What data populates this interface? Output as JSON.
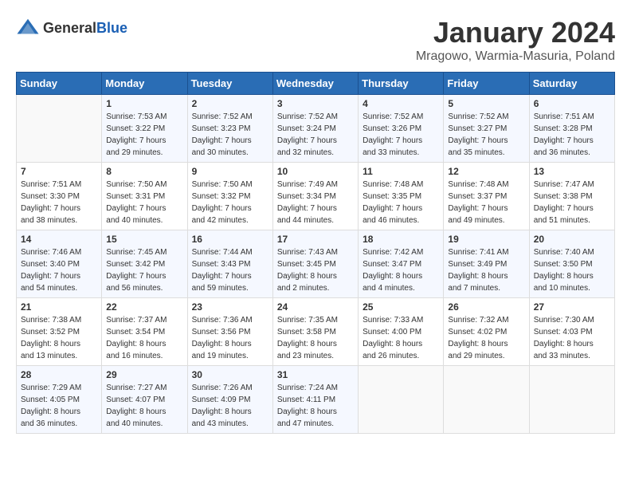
{
  "logo": {
    "text_general": "General",
    "text_blue": "Blue"
  },
  "title": "January 2024",
  "location": "Mragowo, Warmia-Masuria, Poland",
  "days_of_week": [
    "Sunday",
    "Monday",
    "Tuesday",
    "Wednesday",
    "Thursday",
    "Friday",
    "Saturday"
  ],
  "weeks": [
    [
      {
        "day": "",
        "info": ""
      },
      {
        "day": "1",
        "info": "Sunrise: 7:53 AM\nSunset: 3:22 PM\nDaylight: 7 hours\nand 29 minutes."
      },
      {
        "day": "2",
        "info": "Sunrise: 7:52 AM\nSunset: 3:23 PM\nDaylight: 7 hours\nand 30 minutes."
      },
      {
        "day": "3",
        "info": "Sunrise: 7:52 AM\nSunset: 3:24 PM\nDaylight: 7 hours\nand 32 minutes."
      },
      {
        "day": "4",
        "info": "Sunrise: 7:52 AM\nSunset: 3:26 PM\nDaylight: 7 hours\nand 33 minutes."
      },
      {
        "day": "5",
        "info": "Sunrise: 7:52 AM\nSunset: 3:27 PM\nDaylight: 7 hours\nand 35 minutes."
      },
      {
        "day": "6",
        "info": "Sunrise: 7:51 AM\nSunset: 3:28 PM\nDaylight: 7 hours\nand 36 minutes."
      }
    ],
    [
      {
        "day": "7",
        "info": "Sunrise: 7:51 AM\nSunset: 3:30 PM\nDaylight: 7 hours\nand 38 minutes."
      },
      {
        "day": "8",
        "info": "Sunrise: 7:50 AM\nSunset: 3:31 PM\nDaylight: 7 hours\nand 40 minutes."
      },
      {
        "day": "9",
        "info": "Sunrise: 7:50 AM\nSunset: 3:32 PM\nDaylight: 7 hours\nand 42 minutes."
      },
      {
        "day": "10",
        "info": "Sunrise: 7:49 AM\nSunset: 3:34 PM\nDaylight: 7 hours\nand 44 minutes."
      },
      {
        "day": "11",
        "info": "Sunrise: 7:48 AM\nSunset: 3:35 PM\nDaylight: 7 hours\nand 46 minutes."
      },
      {
        "day": "12",
        "info": "Sunrise: 7:48 AM\nSunset: 3:37 PM\nDaylight: 7 hours\nand 49 minutes."
      },
      {
        "day": "13",
        "info": "Sunrise: 7:47 AM\nSunset: 3:38 PM\nDaylight: 7 hours\nand 51 minutes."
      }
    ],
    [
      {
        "day": "14",
        "info": "Sunrise: 7:46 AM\nSunset: 3:40 PM\nDaylight: 7 hours\nand 54 minutes."
      },
      {
        "day": "15",
        "info": "Sunrise: 7:45 AM\nSunset: 3:42 PM\nDaylight: 7 hours\nand 56 minutes."
      },
      {
        "day": "16",
        "info": "Sunrise: 7:44 AM\nSunset: 3:43 PM\nDaylight: 7 hours\nand 59 minutes."
      },
      {
        "day": "17",
        "info": "Sunrise: 7:43 AM\nSunset: 3:45 PM\nDaylight: 8 hours\nand 2 minutes."
      },
      {
        "day": "18",
        "info": "Sunrise: 7:42 AM\nSunset: 3:47 PM\nDaylight: 8 hours\nand 4 minutes."
      },
      {
        "day": "19",
        "info": "Sunrise: 7:41 AM\nSunset: 3:49 PM\nDaylight: 8 hours\nand 7 minutes."
      },
      {
        "day": "20",
        "info": "Sunrise: 7:40 AM\nSunset: 3:50 PM\nDaylight: 8 hours\nand 10 minutes."
      }
    ],
    [
      {
        "day": "21",
        "info": "Sunrise: 7:38 AM\nSunset: 3:52 PM\nDaylight: 8 hours\nand 13 minutes."
      },
      {
        "day": "22",
        "info": "Sunrise: 7:37 AM\nSunset: 3:54 PM\nDaylight: 8 hours\nand 16 minutes."
      },
      {
        "day": "23",
        "info": "Sunrise: 7:36 AM\nSunset: 3:56 PM\nDaylight: 8 hours\nand 19 minutes."
      },
      {
        "day": "24",
        "info": "Sunrise: 7:35 AM\nSunset: 3:58 PM\nDaylight: 8 hours\nand 23 minutes."
      },
      {
        "day": "25",
        "info": "Sunrise: 7:33 AM\nSunset: 4:00 PM\nDaylight: 8 hours\nand 26 minutes."
      },
      {
        "day": "26",
        "info": "Sunrise: 7:32 AM\nSunset: 4:02 PM\nDaylight: 8 hours\nand 29 minutes."
      },
      {
        "day": "27",
        "info": "Sunrise: 7:30 AM\nSunset: 4:03 PM\nDaylight: 8 hours\nand 33 minutes."
      }
    ],
    [
      {
        "day": "28",
        "info": "Sunrise: 7:29 AM\nSunset: 4:05 PM\nDaylight: 8 hours\nand 36 minutes."
      },
      {
        "day": "29",
        "info": "Sunrise: 7:27 AM\nSunset: 4:07 PM\nDaylight: 8 hours\nand 40 minutes."
      },
      {
        "day": "30",
        "info": "Sunrise: 7:26 AM\nSunset: 4:09 PM\nDaylight: 8 hours\nand 43 minutes."
      },
      {
        "day": "31",
        "info": "Sunrise: 7:24 AM\nSunset: 4:11 PM\nDaylight: 8 hours\nand 47 minutes."
      },
      {
        "day": "",
        "info": ""
      },
      {
        "day": "",
        "info": ""
      },
      {
        "day": "",
        "info": ""
      }
    ]
  ]
}
